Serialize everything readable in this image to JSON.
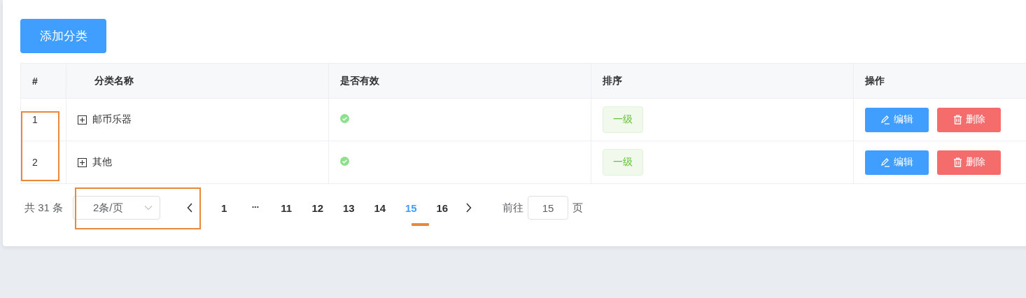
{
  "add_button": "添加分类",
  "table": {
    "columns": [
      "#",
      "分类名称",
      "是否有效",
      "排序",
      "操作"
    ],
    "rows": [
      {
        "index": "1",
        "name": "邮币乐器",
        "expanded": false,
        "valid": true,
        "level_tag": "一级",
        "edit": "编辑",
        "delete": "删除"
      },
      {
        "index": "2",
        "name": "其他",
        "expanded": false,
        "valid": true,
        "level_tag": "一级",
        "edit": "编辑",
        "delete": "删除"
      }
    ]
  },
  "pagination": {
    "total": "共 31 条",
    "page_size": "2条/页",
    "pages": [
      {
        "label": "1",
        "kind": "page",
        "selected": false
      },
      {
        "label": "···",
        "kind": "more",
        "selected": false
      },
      {
        "label": "11",
        "kind": "page",
        "selected": false
      },
      {
        "label": "12",
        "kind": "page",
        "selected": false
      },
      {
        "label": "13",
        "kind": "page",
        "selected": false
      },
      {
        "label": "14",
        "kind": "page",
        "selected": false
      },
      {
        "label": "15",
        "kind": "page",
        "selected": true
      },
      {
        "label": "16",
        "kind": "page",
        "selected": false
      }
    ],
    "jump_label": "前往",
    "jump_value": "15",
    "page_label": "页"
  }
}
